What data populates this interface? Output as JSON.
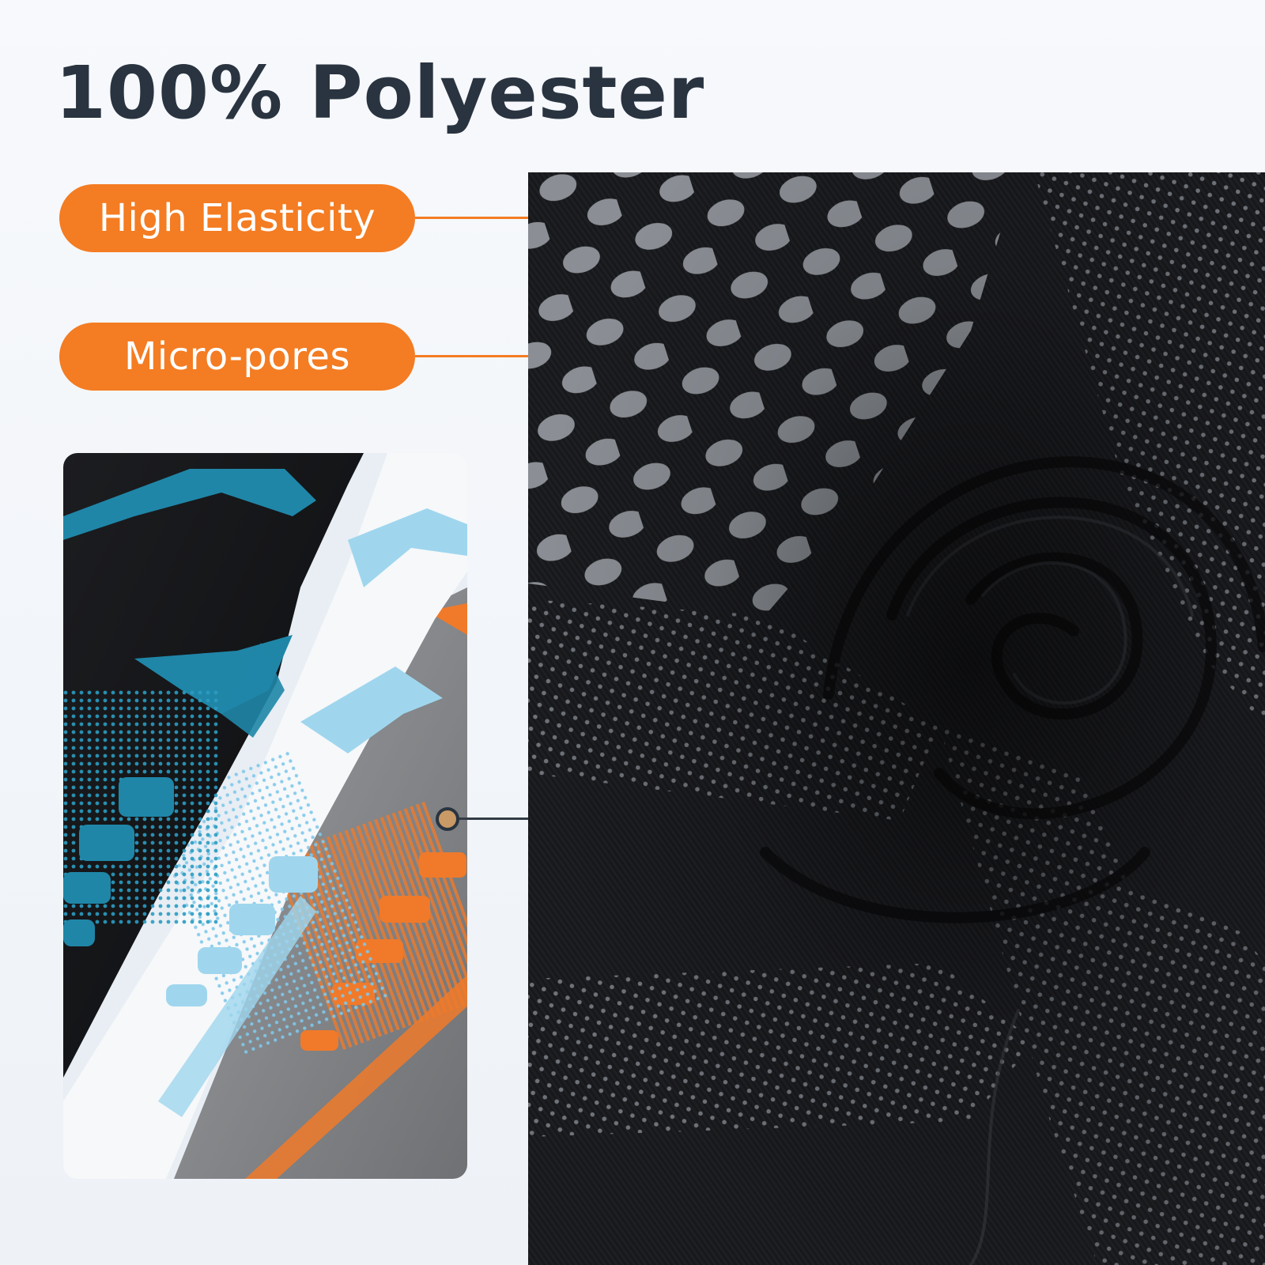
{
  "heading": "100% Polyester",
  "features": [
    {
      "label": "High Elasticity"
    },
    {
      "label": "Micro-pores"
    }
  ],
  "colors": {
    "accent_orange": "#f47c22",
    "title_text": "#2a3440",
    "background": "#f3f6fa",
    "fabric_black": "#141518",
    "shirt_teal": "#1f86a8",
    "shirt_light_blue": "#9fd6ee",
    "shirt_gray": "#8a8c8f"
  }
}
